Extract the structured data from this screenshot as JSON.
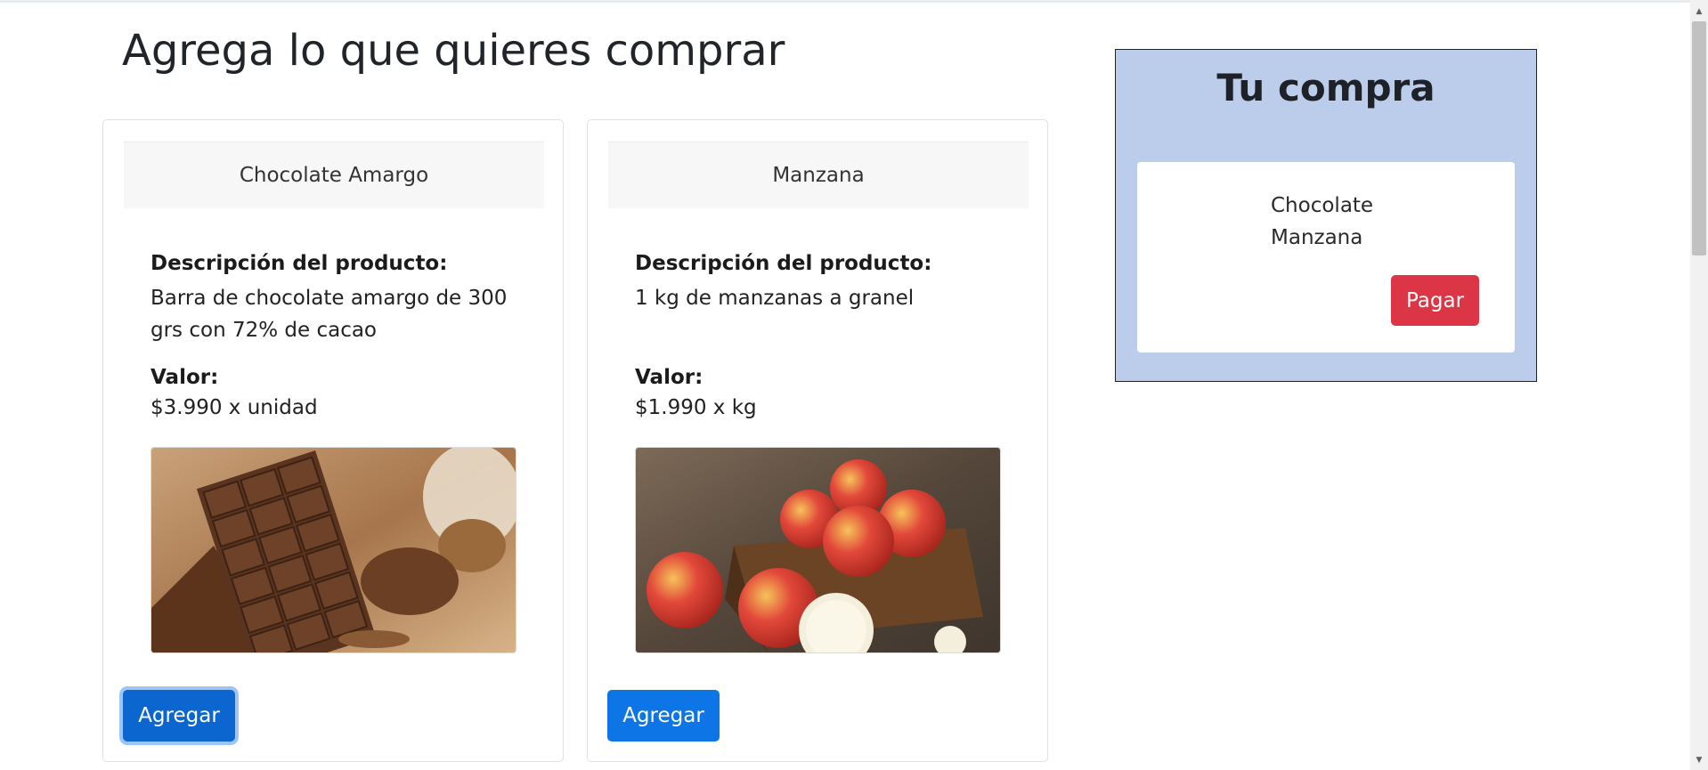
{
  "page": {
    "title": "Agrega lo que quieres comprar"
  },
  "products": [
    {
      "name": "Chocolate Amargo",
      "desc_label": "Descripción del producto:",
      "description": "Barra de chocolate amargo de 300 grs con 72% de cacao",
      "value_label": "Valor:",
      "value": "$3.990 x unidad",
      "image": "dark-chocolate-bars-photo",
      "button": "Agregar"
    },
    {
      "name": "Manzana",
      "desc_label": "Descripción del producto:",
      "description": "1 kg de manzanas a granel",
      "value_label": "Valor:",
      "value": "$1.990 x kg",
      "image": "red-apples-crate-photo",
      "button": "Agregar"
    }
  ],
  "cart": {
    "title": "Tu compra",
    "items": [
      "Chocolate",
      "Manzana"
    ],
    "pay_button": "Pagar"
  },
  "colors": {
    "primary": "#0d75e6",
    "danger": "#dc3545",
    "cart_bg": "#bccdeb"
  },
  "icons": {
    "scroll_up": "triangle-up-icon",
    "scroll_down": "triangle-down-icon"
  }
}
